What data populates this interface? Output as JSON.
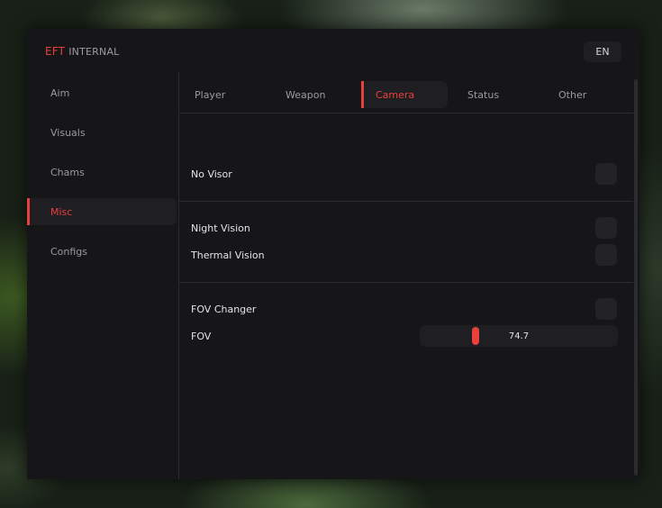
{
  "window": {
    "brand": "EFT",
    "subtitle": "INTERNAL",
    "language": "EN"
  },
  "sidebar": {
    "items": [
      {
        "label": "Aim",
        "active": false
      },
      {
        "label": "Visuals",
        "active": false
      },
      {
        "label": "Chams",
        "active": false
      },
      {
        "label": "Misc",
        "active": true
      },
      {
        "label": "Configs",
        "active": false
      }
    ]
  },
  "tabs": [
    {
      "label": "Player",
      "active": false
    },
    {
      "label": "Weapon",
      "active": false
    },
    {
      "label": "Camera",
      "active": true
    },
    {
      "label": "Status",
      "active": false
    },
    {
      "label": "Other",
      "active": false
    }
  ],
  "options": {
    "no_visor": {
      "label": "No Visor",
      "checked": false
    },
    "night_vision": {
      "label": "Night Vision",
      "checked": false
    },
    "thermal_vision": {
      "label": "Thermal Vision",
      "checked": false
    },
    "fov_changer": {
      "label": "FOV Changer",
      "checked": false
    },
    "fov": {
      "label": "FOV",
      "value": "74.7"
    }
  },
  "colors": {
    "accent": "#e8403a",
    "panel": "#161619",
    "control": "#232327"
  }
}
